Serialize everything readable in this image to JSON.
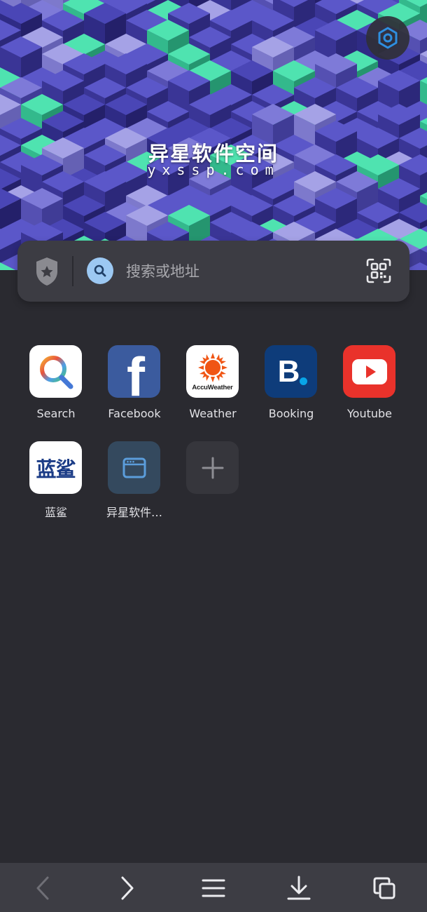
{
  "hero": {
    "watermark_title": "异星软件空间",
    "watermark_domain": "yxssp.com",
    "settings_icon": "hexagon-settings-icon"
  },
  "search_bar": {
    "placeholder": "搜索或地址",
    "left_icon": "shield-star-icon",
    "search_icon": "magnifier-icon",
    "right_icon": "qr-scan-icon"
  },
  "shortcuts": [
    {
      "label": "Search",
      "icon": "search-magnifier-icon"
    },
    {
      "label": "Facebook",
      "icon": "facebook-icon",
      "logo_text": "f"
    },
    {
      "label": "Weather",
      "icon": "accuweather-icon",
      "logo_text": "AccuWeather"
    },
    {
      "label": "Booking",
      "icon": "booking-icon",
      "logo_text": "B"
    },
    {
      "label": "Youtube",
      "icon": "youtube-icon"
    },
    {
      "label": "蓝鲨",
      "icon": "lanshark-icon",
      "logo_text": "蓝鲨"
    },
    {
      "label": "异星软件…",
      "icon": "browser-window-icon"
    },
    {
      "label": "",
      "icon": "plus-icon"
    }
  ],
  "bottom_nav": {
    "back_icon": "chevron-left-icon",
    "forward_icon": "chevron-right-icon",
    "menu_icon": "hamburger-menu-icon",
    "download_icon": "download-icon",
    "tabs_icon": "tabs-icon"
  },
  "colors": {
    "background": "#2a2a30",
    "search_bar": "#3c3c43",
    "bottom_nav": "#3d3d44",
    "accent_blue": "#2e8ee0",
    "cube_green": "#4fe3b0",
    "cube_purple": "#4a46b6"
  }
}
